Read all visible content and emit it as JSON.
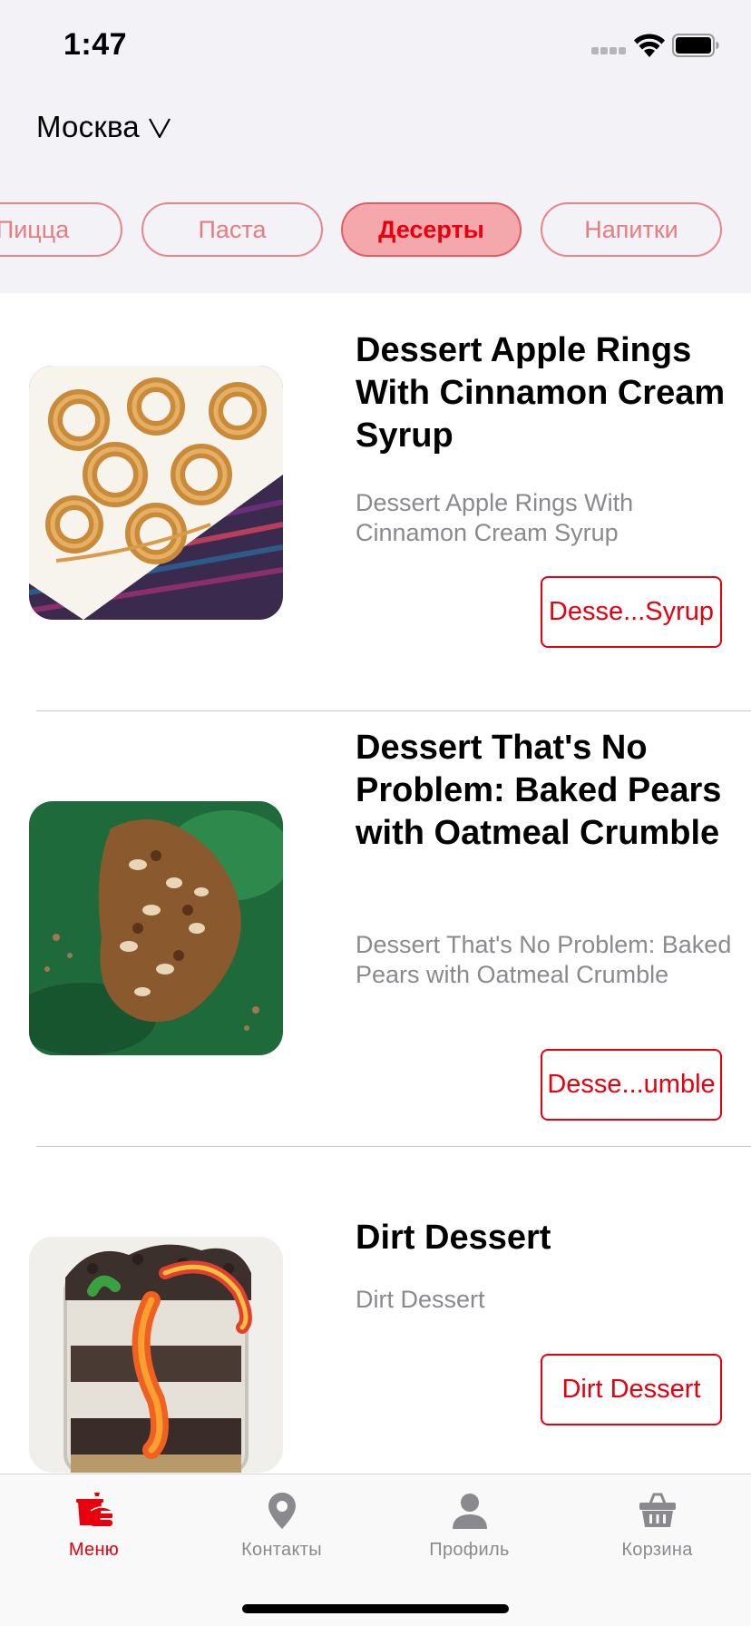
{
  "status_bar": {
    "time": "1:47"
  },
  "header": {
    "city": "Москва"
  },
  "categories": [
    {
      "label": "Пицца",
      "active": false
    },
    {
      "label": "Паста",
      "active": false
    },
    {
      "label": "Десерты",
      "active": true
    },
    {
      "label": "Напитки",
      "active": false
    }
  ],
  "items": [
    {
      "title": "Dessert Apple Rings With Cinnamon Cream Syrup",
      "description": "Dessert Apple Rings With Cinnamon Cream Syrup",
      "button_label": "Desse...Syrup",
      "image_icon": "apple-rings-photo"
    },
    {
      "title": "Dessert That's No Problem: Baked Pears with Oatmeal Crumble",
      "description": "Dessert That's No Problem: Baked Pears with Oatmeal Crumble",
      "button_label": "Desse...umble",
      "image_icon": "baked-pear-photo"
    },
    {
      "title": "Dirt Dessert",
      "description": "Dirt Dessert",
      "button_label": "Dirt Dessert",
      "image_icon": "dirt-dessert-photo"
    }
  ],
  "tabbar": [
    {
      "label": "Меню",
      "icon": "fastfood-icon",
      "active": true
    },
    {
      "label": "Контакты",
      "icon": "location-pin-icon",
      "active": false
    },
    {
      "label": "Профиль",
      "icon": "person-icon",
      "active": false
    },
    {
      "label": "Корзина",
      "icon": "basket-icon",
      "active": false
    }
  ],
  "colors": {
    "accent": "#e8000f",
    "chip_border": "#e8858a",
    "chip_active_bg": "#f5a8ab",
    "header_bg": "#f2f2f7",
    "secondary_text": "#8a8a8e"
  }
}
